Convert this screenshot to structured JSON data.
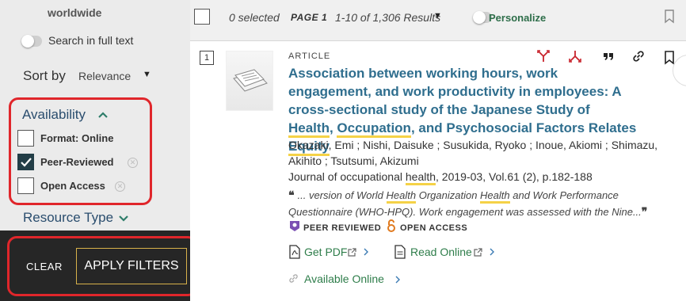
{
  "sidebar": {
    "partial_option_label": "worldwide",
    "full_text_label": "Search in full text",
    "sort_label": "Sort by",
    "sort_value": "Relevance",
    "availability": {
      "title": "Availability",
      "options": [
        {
          "label": "Format: Online",
          "checked": false
        },
        {
          "label": "Peer-Reviewed",
          "checked": true
        },
        {
          "label": "Open Access",
          "checked": false
        }
      ]
    },
    "resource_type_title": "Resource Type",
    "clear_label": "CLEAR",
    "apply_label": "APPLY FILTERS"
  },
  "topbar": {
    "selected_count": "0 selected",
    "page_label": "PAGE 1",
    "results_range": "1-10 of 1,306 Results",
    "personalize_label": "Personalize"
  },
  "result": {
    "number": "1",
    "type": "ARTICLE",
    "title_parts": {
      "p1": "Association between working hours, work engagement, and work productivity in employees: A cross-sectional study of the Japanese Study of ",
      "hl1": "Health",
      "p2": ", ",
      "hl2": "Occupation",
      "p3": ", and Psychosocial Factors Relates ",
      "hl3": "Equity"
    },
    "authors": "Okazaki, Emi ; Nishi, Daisuke ; Susukida, Ryoko ; Inoue, Akiomi ; Shimazu, Akihito ; Tsutsumi, Akizumi",
    "journal_parts": {
      "p1": "Journal of occupational ",
      "hl": "health",
      "p2": ", 2019-03, Vol.61 (2), p.182-188"
    },
    "snippet_parts": {
      "p1": "... version of World ",
      "hl1": "Health",
      "p2": " Organization ",
      "hl2": "Health",
      "p3": " and Work Performance Questionnaire (WHO-HPQ). Work engagement was assessed with the Nine..."
    },
    "badges": {
      "peer_reviewed": "PEER REVIEWED",
      "open_access": "OPEN ACCESS"
    },
    "links": {
      "get_pdf": "Get PDF",
      "read_online": "Read Online",
      "available_online": "Available Online"
    }
  },
  "colors": {
    "accent_red": "#e0262b",
    "link_green": "#2e7d4a",
    "title_blue": "#2f6e8e",
    "highlight_yellow": "#f5d247",
    "apply_border": "#d8b24a"
  },
  "icons": [
    "chevron-up-icon",
    "chevron-down-icon",
    "check-icon",
    "remove-filter-icon",
    "bookmark-icon",
    "cited-icon",
    "citing-icon",
    "quote-icon",
    "link-icon",
    "peer-reviewed-icon",
    "open-access-icon",
    "pdf-icon",
    "document-icon",
    "external-link-icon",
    "chevron-right-icon"
  ]
}
